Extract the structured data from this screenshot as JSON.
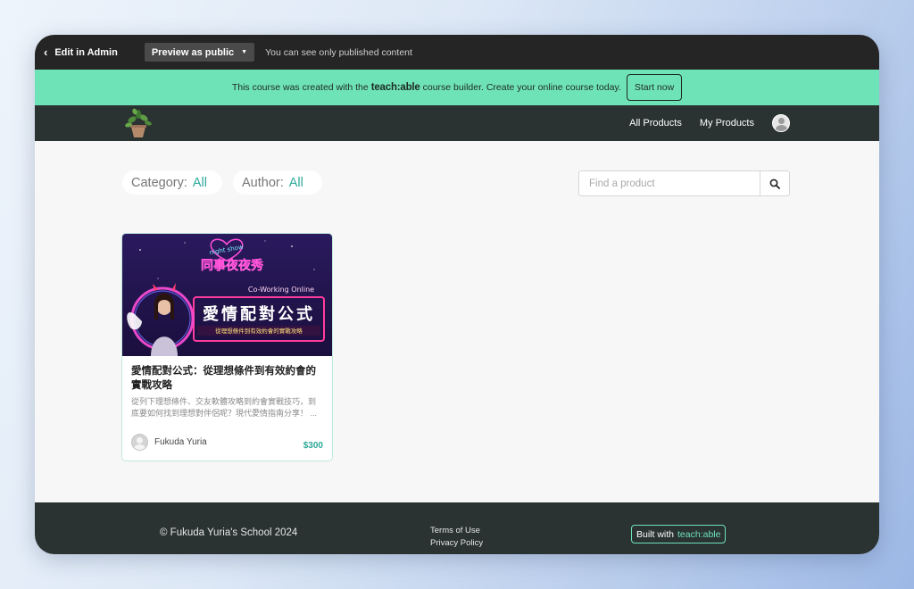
{
  "admin_bar": {
    "back_label": "Edit in Admin",
    "preview_label": "Preview as public",
    "note": "You can see only published content"
  },
  "promo": {
    "text_before": "This course was created with the",
    "brand": "teach:able",
    "text_after": "course builder. Create your online course today.",
    "cta": "Start now"
  },
  "nav": {
    "links": [
      "All Products",
      "My Products"
    ]
  },
  "filters": {
    "category_label": "Category:",
    "category_value": "All",
    "author_label": "Author:",
    "author_value": "All"
  },
  "search": {
    "placeholder": "Find a product"
  },
  "products": [
    {
      "image_texts": {
        "badge": "night show",
        "headline": "同事夜夜秀",
        "subtitle": "Co-Working Online",
        "main": "愛情配對公式",
        "tagline": "從理想條件到有效約會的實戰攻略"
      },
      "title": "愛情配對公式：從理想條件到有效約會的實戰攻略",
      "description": "從列下理想條件、交友軟體攻略到約會實戰技巧，到底要如何找到理想對伴侶呢？現代愛情指南分享！ ...",
      "author": "Fukuda Yuria",
      "price": "$300"
    }
  ],
  "footer": {
    "copyright": "© Fukuda Yuria's School 2024",
    "terms": "Terms of Use",
    "privacy": "Privacy Policy",
    "built_prefix": "Built with",
    "built_brand": "teach:able"
  },
  "colors": {
    "promo_bg": "#6fe3b8",
    "nav_bg": "#2a3232",
    "accent": "#2fa99a"
  }
}
